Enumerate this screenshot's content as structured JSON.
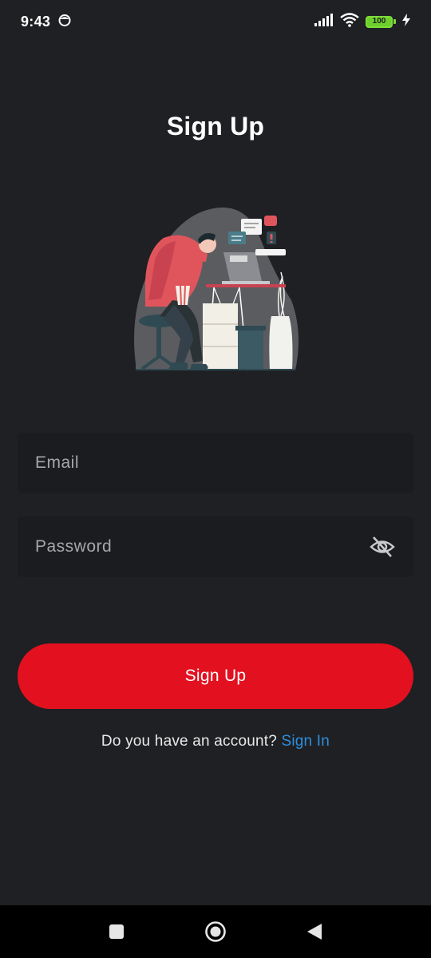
{
  "status_bar": {
    "time": "9:43",
    "battery_level": "100",
    "icons": [
      "notification-face-icon",
      "signal-icon",
      "wifi-icon",
      "battery-icon",
      "charging-bolt-icon"
    ]
  },
  "page": {
    "title": "Sign Up"
  },
  "illustration": {
    "icon": "person-working-at-desk-illustration"
  },
  "form": {
    "email_placeholder": "Email",
    "email_value": "",
    "password_placeholder": "Password",
    "password_value": "",
    "password_toggle_icon": "eye-off-icon",
    "submit_label": "Sign Up"
  },
  "footer": {
    "prompt": "Do you have an account?",
    "link_label": "Sign In"
  },
  "nav_bar": {
    "icons": [
      "recents-square-icon",
      "home-circle-icon",
      "back-triangle-icon"
    ]
  },
  "colors": {
    "background": "#1f2023",
    "field_background": "#1b1c1f",
    "accent": "#e31120",
    "link": "#2d8fe0"
  }
}
